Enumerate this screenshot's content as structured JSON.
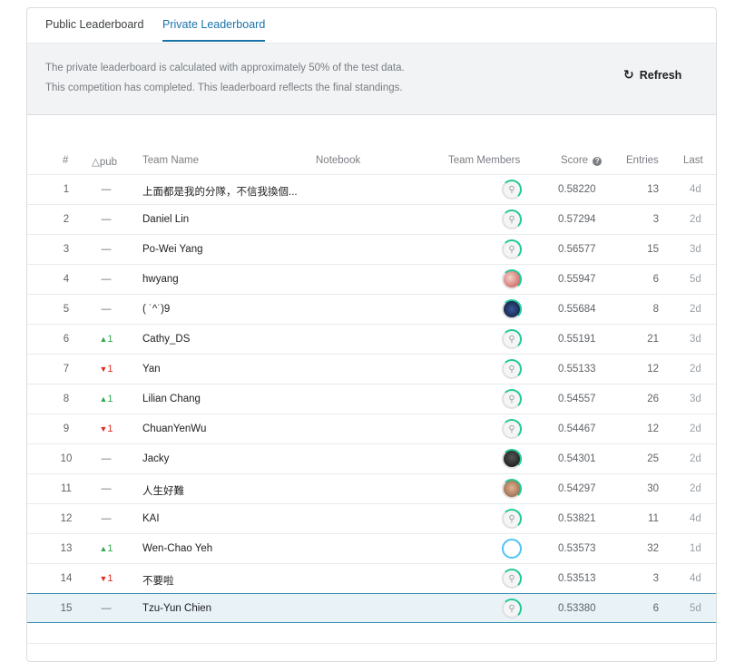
{
  "tabs": {
    "public": "Public Leaderboard",
    "private": "Private Leaderboard"
  },
  "info": {
    "line1": "The private leaderboard is calculated with approximately 50% of the test data.",
    "line2": "This competition has completed. This leaderboard reflects the final standings.",
    "refresh_label": "Refresh",
    "refresh_icon": "↻"
  },
  "columns": {
    "rank": "#",
    "delta": "△pub",
    "team": "Team Name",
    "notebook": "Notebook",
    "members": "Team Members",
    "score": "Score",
    "entries": "Entries",
    "last": "Last"
  },
  "colors": {
    "accent": "#1a73a8",
    "up": "#34a853",
    "down": "#d93025",
    "ring": "#20c997",
    "highlight_bg": "#e8f2f7",
    "highlight_border": "#3d8fb3"
  },
  "rows": [
    {
      "rank": "1",
      "delta_dir": "none",
      "delta": "—",
      "team": "上面都是我的分隊，不信我換個...",
      "avatar": "default",
      "score": "0.58220",
      "entries": "13",
      "last": "4d"
    },
    {
      "rank": "2",
      "delta_dir": "none",
      "delta": "—",
      "team": "Daniel Lin",
      "avatar": "default",
      "score": "0.57294",
      "entries": "3",
      "last": "2d"
    },
    {
      "rank": "3",
      "delta_dir": "none",
      "delta": "—",
      "team": "Po-Wei Yang",
      "avatar": "default",
      "score": "0.56577",
      "entries": "15",
      "last": "3d"
    },
    {
      "rank": "4",
      "delta_dir": "none",
      "delta": "—",
      "team": "hwyang",
      "avatar": "photo-red",
      "score": "0.55947",
      "entries": "6",
      "last": "5d"
    },
    {
      "rank": "5",
      "delta_dir": "none",
      "delta": "—",
      "team": "( ˙^˙)9",
      "avatar": "photo-night",
      "score": "0.55684",
      "entries": "8",
      "last": "2d"
    },
    {
      "rank": "6",
      "delta_dir": "up",
      "delta": "1",
      "team": "Cathy_DS",
      "avatar": "default",
      "score": "0.55191",
      "entries": "21",
      "last": "3d"
    },
    {
      "rank": "7",
      "delta_dir": "down",
      "delta": "1",
      "team": "Yan",
      "avatar": "default",
      "score": "0.55133",
      "entries": "12",
      "last": "2d"
    },
    {
      "rank": "8",
      "delta_dir": "up",
      "delta": "1",
      "team": "Lilian Chang",
      "avatar": "default",
      "score": "0.54557",
      "entries": "26",
      "last": "3d"
    },
    {
      "rank": "9",
      "delta_dir": "down",
      "delta": "1",
      "team": "ChuanYenWu",
      "avatar": "default",
      "score": "0.54467",
      "entries": "12",
      "last": "2d"
    },
    {
      "rank": "10",
      "delta_dir": "none",
      "delta": "—",
      "team": "Jacky",
      "avatar": "photo-dark",
      "score": "0.54301",
      "entries": "25",
      "last": "2d"
    },
    {
      "rank": "11",
      "delta_dir": "none",
      "delta": "—",
      "team": "人生好難",
      "avatar": "photo-face",
      "score": "0.54297",
      "entries": "30",
      "last": "2d"
    },
    {
      "rank": "12",
      "delta_dir": "none",
      "delta": "—",
      "team": "KAI",
      "avatar": "default",
      "score": "0.53821",
      "entries": "11",
      "last": "4d"
    },
    {
      "rank": "13",
      "delta_dir": "up",
      "delta": "1",
      "team": "Wen-Chao Yeh",
      "avatar": "photo-cartoon",
      "score": "0.53573",
      "entries": "32",
      "last": "1d"
    },
    {
      "rank": "14",
      "delta_dir": "down",
      "delta": "1",
      "team": "不要啦",
      "avatar": "default",
      "score": "0.53513",
      "entries": "3",
      "last": "4d"
    },
    {
      "rank": "15",
      "delta_dir": "none",
      "delta": "—",
      "team": "Tzu-Yun Chien",
      "avatar": "default",
      "score": "0.53380",
      "entries": "6",
      "last": "5d",
      "highlight": true
    }
  ]
}
